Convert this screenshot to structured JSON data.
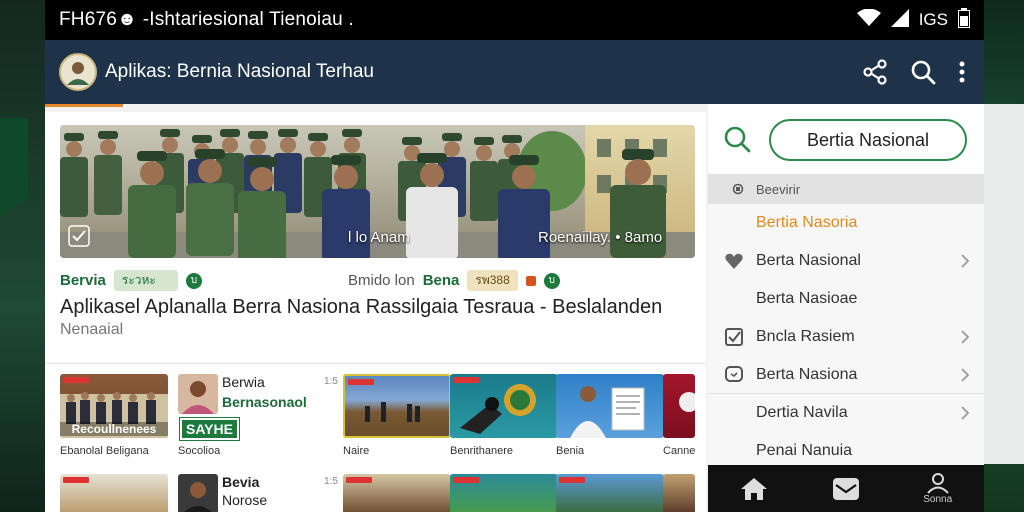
{
  "status_bar": {
    "text": "FH676☻ -Ishtariesional Tienoiau .",
    "battery": "IGS"
  },
  "app_bar": {
    "title": "Aplikas: Bernia Nasional Terhau",
    "icons": [
      "share-icon",
      "search-icon",
      "more-vertical-icon"
    ]
  },
  "feed": {
    "hero_caption_left": "l lo Anam",
    "hero_caption_right": "Roenaiilay. • 8amo",
    "meta_left": {
      "category": "Bervia",
      "pill": "ระวหะ",
      "dot": "บ"
    },
    "meta_right": {
      "source": "Bmido lon",
      "category": "Bena",
      "pill": "รพ388",
      "dot": "บ"
    },
    "headline": "Aplikasel Aplanalla Berra Nasiona  Rassilgaia Tesraua - Beslalanden",
    "subline": "Nenaaial",
    "tiles": [
      {
        "label": "Ebanolal Beligana",
        "overlay": "Recoullnenees"
      },
      {
        "label": "Socolioa",
        "title_1": "Berwia",
        "title_2": "Bernasonaol",
        "stamp": "SAYHE",
        "num": "1:5"
      },
      {
        "label": "Naire"
      },
      {
        "label": "Benrithanere"
      },
      {
        "label": "Benia"
      },
      {
        "label": "Canne"
      }
    ],
    "row2": {
      "title_1": "Bevia",
      "title_2": "Norose",
      "num": "1:5"
    }
  },
  "sidebar": {
    "search_value": "Bertia Nasional",
    "menu_header": "Beevirir",
    "items": [
      {
        "label": "Bertia Nasoria",
        "icon": "",
        "style": "orange"
      },
      {
        "label": "Berta Nasional",
        "icon": "heart-icon",
        "style": ""
      },
      {
        "label": "Berta Nasioae",
        "icon": "",
        "style": ""
      },
      {
        "label": "Bncla Rasiem",
        "icon": "checkbox-icon",
        "style": ""
      },
      {
        "label": "Berta Nasiona",
        "icon": "chat-icon",
        "style": ""
      },
      {
        "label": "Dertia Navila",
        "icon": "",
        "style": ""
      },
      {
        "label": "Penai Nanuia",
        "icon": "",
        "style": ""
      }
    ],
    "bottom_nav": [
      {
        "icon": "home-icon",
        "label": ""
      },
      {
        "icon": "mail-icon",
        "label": ""
      },
      {
        "icon": "profile-icon",
        "label": "Sonna"
      }
    ]
  },
  "colors": {
    "app_bar": "#1e3249",
    "accent_green": "#1d6b38",
    "accent_orange": "#e08a1e",
    "search_border": "#2b8a4d"
  }
}
